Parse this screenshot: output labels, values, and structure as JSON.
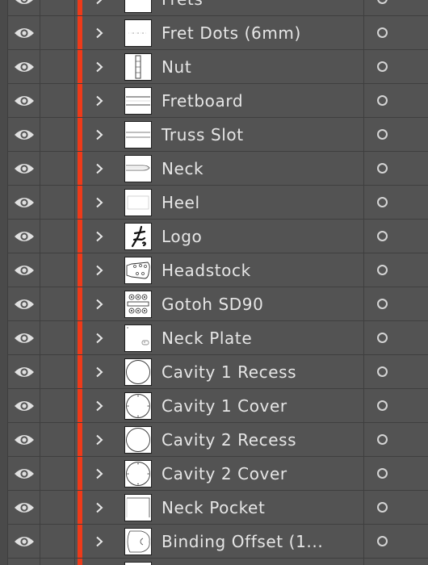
{
  "panel": {
    "layer_color": "#ee3a19",
    "layers": [
      {
        "name": "Frets",
        "thumb": "frets"
      },
      {
        "name": "Fret Dots (6mm)",
        "thumb": "fretdots"
      },
      {
        "name": "Nut",
        "thumb": "nut"
      },
      {
        "name": "Fretboard",
        "thumb": "fretboard"
      },
      {
        "name": "Truss Slot",
        "thumb": "trussslot"
      },
      {
        "name": "Neck",
        "thumb": "neck"
      },
      {
        "name": "Heel",
        "thumb": "heel"
      },
      {
        "name": "Logo",
        "thumb": "logo"
      },
      {
        "name": "Headstock",
        "thumb": "headstock"
      },
      {
        "name": "Gotoh SD90",
        "thumb": "gotoh"
      },
      {
        "name": "Neck Plate",
        "thumb": "neckplate"
      },
      {
        "name": "Cavity 1 Recess",
        "thumb": "cavity"
      },
      {
        "name": "Cavity 1 Cover",
        "thumb": "cavitycover"
      },
      {
        "name": "Cavity 2 Recess",
        "thumb": "cavity"
      },
      {
        "name": "Cavity 2 Cover",
        "thumb": "cavitycover"
      },
      {
        "name": "Neck Pocket",
        "thumb": "neckpocket"
      },
      {
        "name": "Binding Offset (1...",
        "thumb": "binding"
      },
      {
        "name": "",
        "thumb": "blank"
      }
    ]
  }
}
